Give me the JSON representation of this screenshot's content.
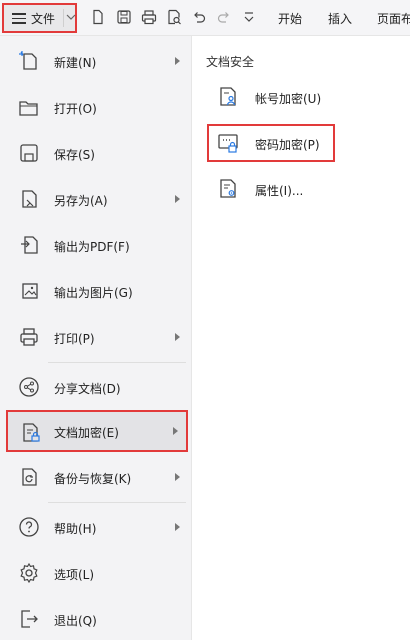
{
  "toolbar": {
    "file_label": "文件",
    "tabs": [
      "开始",
      "插入",
      "页面布"
    ]
  },
  "menu": {
    "items": [
      {
        "label": "新建(N)",
        "icon": "new-doc-icon",
        "submenu": true
      },
      {
        "label": "打开(O)",
        "icon": "folder-open-icon",
        "submenu": false
      },
      {
        "label": "保存(S)",
        "icon": "save-icon",
        "submenu": false
      },
      {
        "label": "另存为(A)",
        "icon": "save-as-icon",
        "submenu": true
      },
      {
        "label": "输出为PDF(F)",
        "icon": "export-pdf-icon",
        "submenu": false
      },
      {
        "label": "输出为图片(G)",
        "icon": "export-image-icon",
        "submenu": false
      },
      {
        "label": "打印(P)",
        "icon": "print-icon",
        "submenu": true
      },
      {
        "label": "分享文档(D)",
        "icon": "share-icon",
        "submenu": false
      },
      {
        "label": "文档加密(E)",
        "icon": "encrypt-doc-icon",
        "submenu": true
      },
      {
        "label": "备份与恢复(K)",
        "icon": "backup-icon",
        "submenu": true
      },
      {
        "label": "帮助(H)",
        "icon": "help-icon",
        "submenu": true
      },
      {
        "label": "选项(L)",
        "icon": "settings-icon",
        "submenu": false
      },
      {
        "label": "退出(Q)",
        "icon": "exit-icon",
        "submenu": false
      }
    ]
  },
  "panel": {
    "title": "文档安全",
    "items": [
      {
        "label": "帐号加密(U)",
        "icon": "account-encrypt-icon"
      },
      {
        "label": "密码加密(P)",
        "icon": "password-encrypt-icon"
      },
      {
        "label": "属性(I)...",
        "icon": "properties-icon"
      }
    ]
  },
  "colors": {
    "highlight": "#e23a3a"
  }
}
